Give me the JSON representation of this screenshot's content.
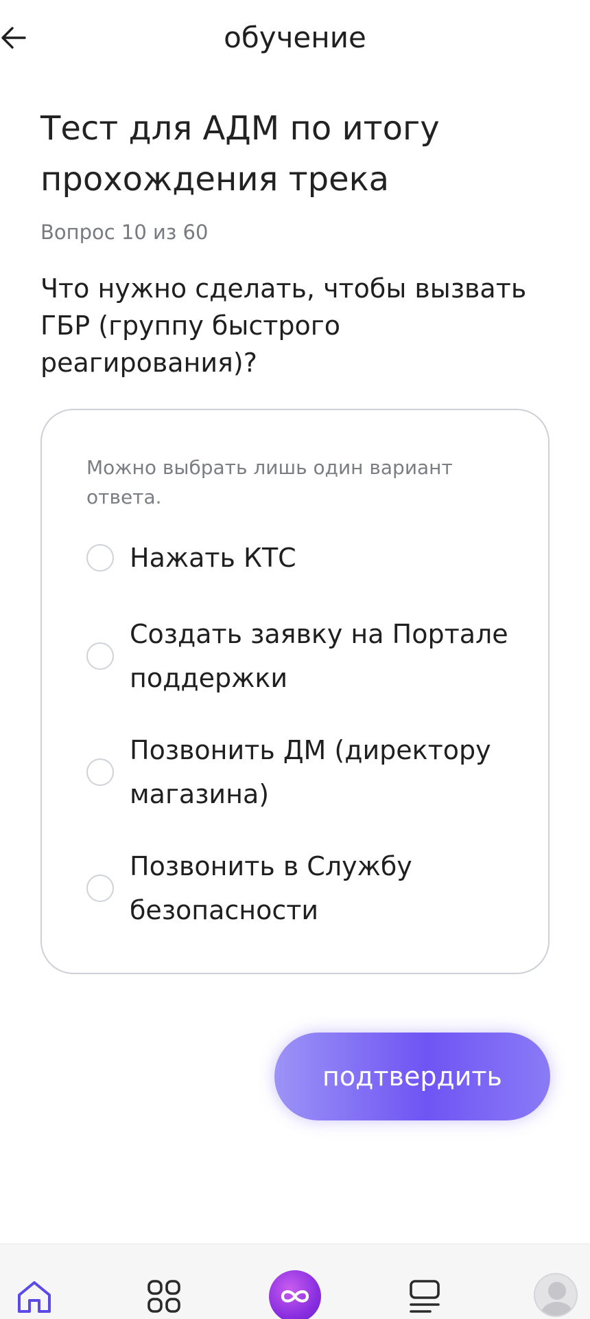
{
  "header": {
    "title": "обучение"
  },
  "test": {
    "title": "Тест для АДМ по итогу прохождения трека",
    "counter": "Вопрос 10 из 60",
    "question": "Что нужно сделать, чтобы вызвать ГБР (группу быстрого реагирования)?"
  },
  "answers": {
    "hint": "Можно выбрать лишь один вариант ответа.",
    "options": [
      "Нажать КТС",
      "Создать заявку на Портале поддержки",
      "Позвонить ДМ (директору магазина)",
      "Позвонить в Службу безопасности"
    ]
  },
  "submit": {
    "label": "подтвердить"
  },
  "colors": {
    "accent": "#6f54f4",
    "accent_light": "#9c93f6",
    "center_orb": "#8a2fe0",
    "nav_home_icon": "#5b49e8"
  },
  "icons": {
    "back": "arrow-left-icon",
    "home": "home-icon",
    "services": "grid-icon",
    "center": "infinity-icon",
    "feed": "feed-icon",
    "profile": "avatar-icon"
  }
}
